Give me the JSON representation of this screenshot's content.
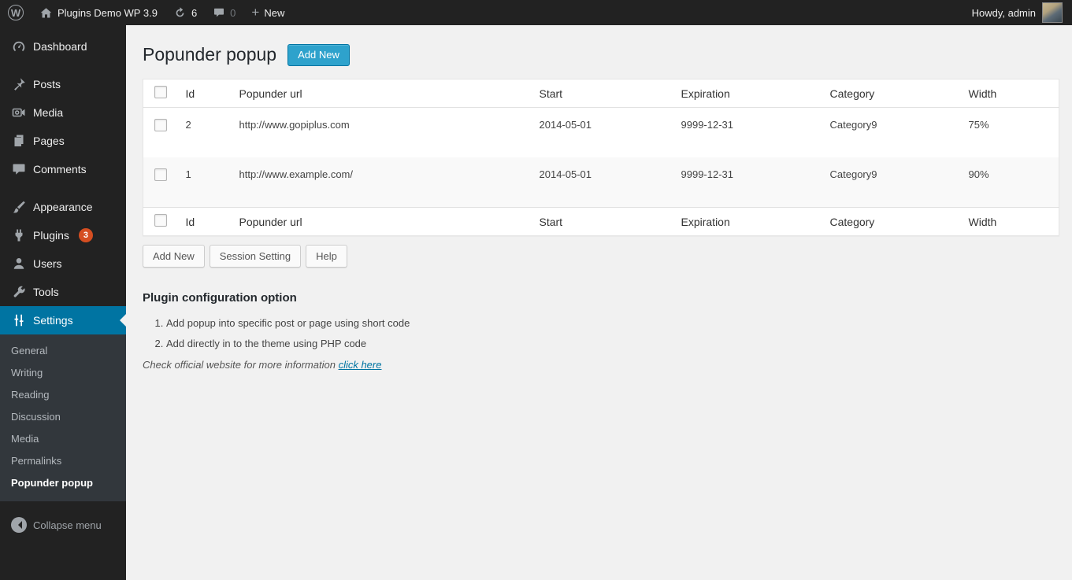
{
  "colors": {
    "adminbar_bg": "#222222",
    "menu_bg": "#222222",
    "submenu_bg": "#32373c",
    "active_blue": "#0074a2",
    "button_blue": "#2ea2cc",
    "badge_red": "#d54e21",
    "link_teal": "#0074a2",
    "page_bg": "#f1f1f1"
  },
  "admin_bar": {
    "site_name": "Plugins Demo WP 3.9",
    "update_count": "6",
    "comment_count": "0",
    "new_label": "New",
    "howdy": "Howdy, admin",
    "icons": [
      "wordpress-icon",
      "home-icon",
      "update-icon",
      "comment-icon",
      "plus-icon",
      "avatar"
    ]
  },
  "sidebar": {
    "items": [
      {
        "label": "Dashboard",
        "icon": "dashboard-icon"
      },
      {
        "label": "Posts",
        "icon": "pushpin-icon"
      },
      {
        "label": "Media",
        "icon": "media-icon"
      },
      {
        "label": "Pages",
        "icon": "pages-icon"
      },
      {
        "label": "Comments",
        "icon": "comments-icon"
      },
      {
        "label": "Appearance",
        "icon": "appearance-brush-icon"
      },
      {
        "label": "Plugins",
        "icon": "plugin-icon",
        "badge": "3"
      },
      {
        "label": "Users",
        "icon": "user-icon"
      },
      {
        "label": "Tools",
        "icon": "wrench-icon"
      },
      {
        "label": "Settings",
        "icon": "settings-sliders-icon",
        "active": true
      }
    ],
    "settings_submenu": [
      {
        "label": "General"
      },
      {
        "label": "Writing"
      },
      {
        "label": "Reading"
      },
      {
        "label": "Discussion"
      },
      {
        "label": "Media"
      },
      {
        "label": "Permalinks"
      },
      {
        "label": "Popunder popup",
        "current": true
      }
    ],
    "collapse_label": "Collapse menu"
  },
  "main": {
    "page_title": "Popunder popup",
    "add_new_button": "Add New",
    "table": {
      "headers": {
        "id": "Id",
        "url": "Popunder url",
        "start": "Start",
        "expiration": "Expiration",
        "category": "Category",
        "width": "Width"
      },
      "rows": [
        {
          "id": "2",
          "url": "http://www.gopiplus.com",
          "start": "2014-05-01",
          "expiration": "9999-12-31",
          "category": "Category9",
          "width": "75%"
        },
        {
          "id": "1",
          "url": "http://www.example.com/",
          "start": "2014-05-01",
          "expiration": "9999-12-31",
          "category": "Category9",
          "width": "90%"
        }
      ]
    },
    "action_buttons": {
      "add_new": "Add New",
      "session_setting": "Session Setting",
      "help": "Help"
    },
    "config": {
      "heading": "Plugin configuration option",
      "items": [
        "Add popup into specific post or page using short code",
        "Add directly in to the theme using PHP code"
      ],
      "footer_text": "Check official website for more information",
      "footer_link": "click here"
    }
  }
}
